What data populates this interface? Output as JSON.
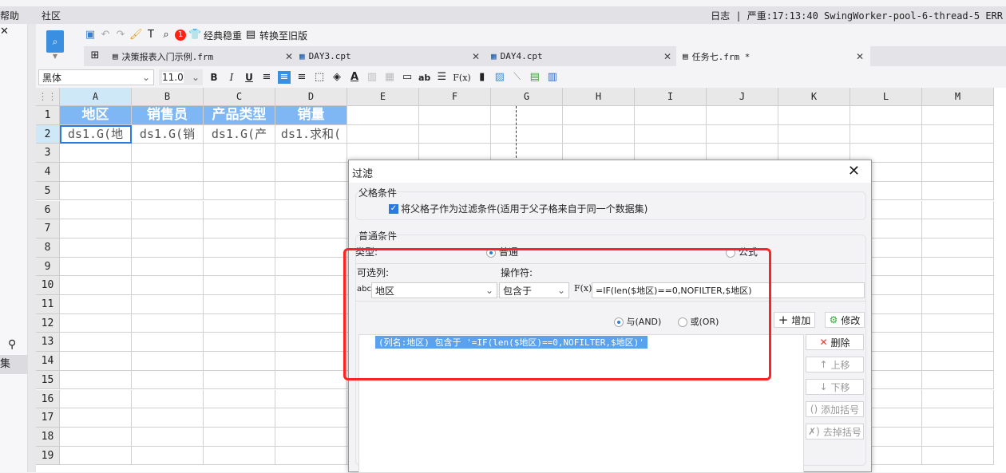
{
  "menu": {
    "items": [
      "帮助",
      "社区"
    ],
    "log": "日志 | 严重:17:13:40 SwingWorker-pool-6-thread-5 ERR"
  },
  "toolbar": {
    "badge": "1",
    "classic": "经典稳重",
    "convert": "转换至旧版"
  },
  "tabs": [
    {
      "label": "决策报表入门示例.frm"
    },
    {
      "label": "DAY3.cpt"
    },
    {
      "label": "DAY4.cpt"
    },
    {
      "label": "任务七.frm *"
    }
  ],
  "format": {
    "font": "黑体",
    "size": "11.0",
    "bold": "B",
    "italic": "I",
    "underline": "U",
    "text_ab": "ab",
    "fx": "F(x)"
  },
  "left": {
    "dataset": "集"
  },
  "grid": {
    "columns": [
      "A",
      "B",
      "C",
      "D",
      "E",
      "F",
      "G",
      "H",
      "I",
      "J",
      "K",
      "L",
      "M"
    ],
    "rows": [
      "1",
      "2",
      "3",
      "4",
      "5",
      "6",
      "7",
      "8",
      "9",
      "10",
      "11",
      "12",
      "13",
      "14",
      "15",
      "16",
      "17",
      "18",
      "19"
    ],
    "header_cells": [
      "地区",
      "销售员",
      "产品类型",
      "销量"
    ],
    "data_cells": [
      "ds1.G(地",
      "ds1.G(销",
      "ds1.G(产",
      "ds1.求和("
    ]
  },
  "dialog": {
    "title": "过滤",
    "parent_group": "父格条件",
    "parent_checkbox": "将父格子作为过滤条件(适用于父子格来自于同一个数据集)",
    "normal_group": "普通条件",
    "type_label": "类型:",
    "type_normal": "普通",
    "type_formula": "公式",
    "column_label": "可选列:",
    "operator_label": "操作符:",
    "column_value": "地区",
    "operator_value": "包含于",
    "formula_value": "=IF(len($地区)==0,NOFILTER,$地区)",
    "and_label": "与(AND)",
    "or_label": "或(OR)",
    "add": "增加",
    "modify": "修改",
    "condition": "(列名:地区) 包含于 '=IF(len($地区)==0,NOFILTER,$地区)'",
    "delete": "删除",
    "up": "上移",
    "down": "下移",
    "add_bracket": "添加括号",
    "remove_bracket": "去掉括号"
  },
  "colors": {
    "accent": "#2a7ae2",
    "header_fill": "#7fb7f5",
    "highlight": "#f22"
  }
}
